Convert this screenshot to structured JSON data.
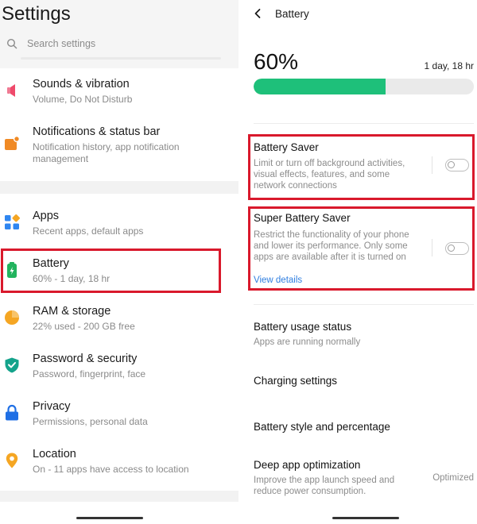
{
  "settings": {
    "title": "Settings",
    "search_placeholder": "Search settings",
    "items": [
      {
        "key": "sounds",
        "title": "Sounds & vibration",
        "subtitle": "Volume, Do Not Disturb",
        "icon": "speaker-icon",
        "color": "#ef4a6b"
      },
      {
        "key": "notifications",
        "title": "Notifications & status bar",
        "subtitle": "Notification history, app notification management",
        "icon": "notification-icon",
        "color": "#f08a25"
      },
      {
        "key": "apps",
        "title": "Apps",
        "subtitle": "Recent apps, default apps",
        "icon": "apps-grid-icon",
        "color": "#2f86f0"
      },
      {
        "key": "battery",
        "title": "Battery",
        "subtitle": "60% - 1 day, 18 hr",
        "icon": "battery-icon",
        "color": "#22b35e"
      },
      {
        "key": "ram",
        "title": "RAM & storage",
        "subtitle": "22% used - 200 GB free",
        "icon": "storage-pie-icon",
        "color": "#f5a623"
      },
      {
        "key": "password",
        "title": "Password & security",
        "subtitle": "Password, fingerprint, face",
        "icon": "shield-icon",
        "color": "#14a38b"
      },
      {
        "key": "privacy",
        "title": "Privacy",
        "subtitle": "Permissions, personal data",
        "icon": "lock-icon",
        "color": "#1f6fe5"
      },
      {
        "key": "location",
        "title": "Location",
        "subtitle": "On - 11 apps have access to location",
        "icon": "location-pin-icon",
        "color": "#f5a623"
      }
    ]
  },
  "battery": {
    "header": "Battery",
    "percent_text": "60%",
    "level": 0.6,
    "remaining": "1 day, 18 hr",
    "bar_color": "#1ec07a",
    "saver": {
      "title": "Battery Saver",
      "description": "Limit or turn off background activities, visual effects, features, and some network connections",
      "enabled": false
    },
    "super_saver": {
      "title": "Super Battery Saver",
      "description": "Restrict the functionality of your phone and lower its performance. Only some apps are available after it is turned on",
      "link": "View details",
      "enabled": false
    },
    "usage": {
      "title": "Battery usage status",
      "subtitle": "Apps are running normally"
    },
    "charging": {
      "title": "Charging settings"
    },
    "style": {
      "title": "Battery style and percentage"
    },
    "deep": {
      "title": "Deep app optimization",
      "subtitle": "Improve the app launch speed and reduce power consumption.",
      "value": "Optimized"
    }
  },
  "highlight_color": "#d9192c"
}
